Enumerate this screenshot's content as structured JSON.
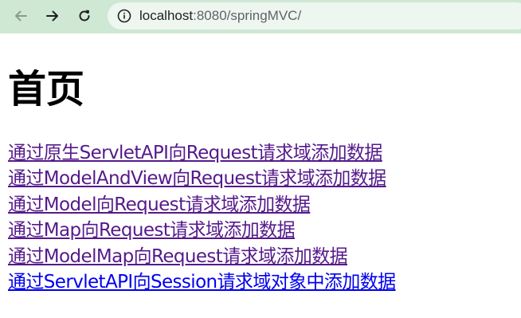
{
  "browser": {
    "url_host": "localhost",
    "url_rest": ":8080/springMVC/",
    "back_icon": "arrow-left-icon",
    "forward_icon": "arrow-right-icon",
    "reload_icon": "reload-icon",
    "info_icon": "info-icon"
  },
  "page": {
    "title": "首页",
    "links": [
      {
        "label": "通过原生ServletAPI向Request请求域添加数据",
        "visited": true
      },
      {
        "label": "通过ModelAndView向Request请求域添加数据",
        "visited": true
      },
      {
        "label": "通过Model向Request请求域添加数据",
        "visited": true
      },
      {
        "label": "通过Map向Request请求域添加数据",
        "visited": true
      },
      {
        "label": "通过ModelMap向Request请求域添加数据",
        "visited": true
      },
      {
        "label": "通过ServletAPI向Session请求域对象中添加数据",
        "visited": false
      }
    ]
  },
  "colors": {
    "toolbar_bg": "#cfe8d4",
    "link_visited": "#551a8b",
    "link_unvisited": "#0000ee"
  }
}
